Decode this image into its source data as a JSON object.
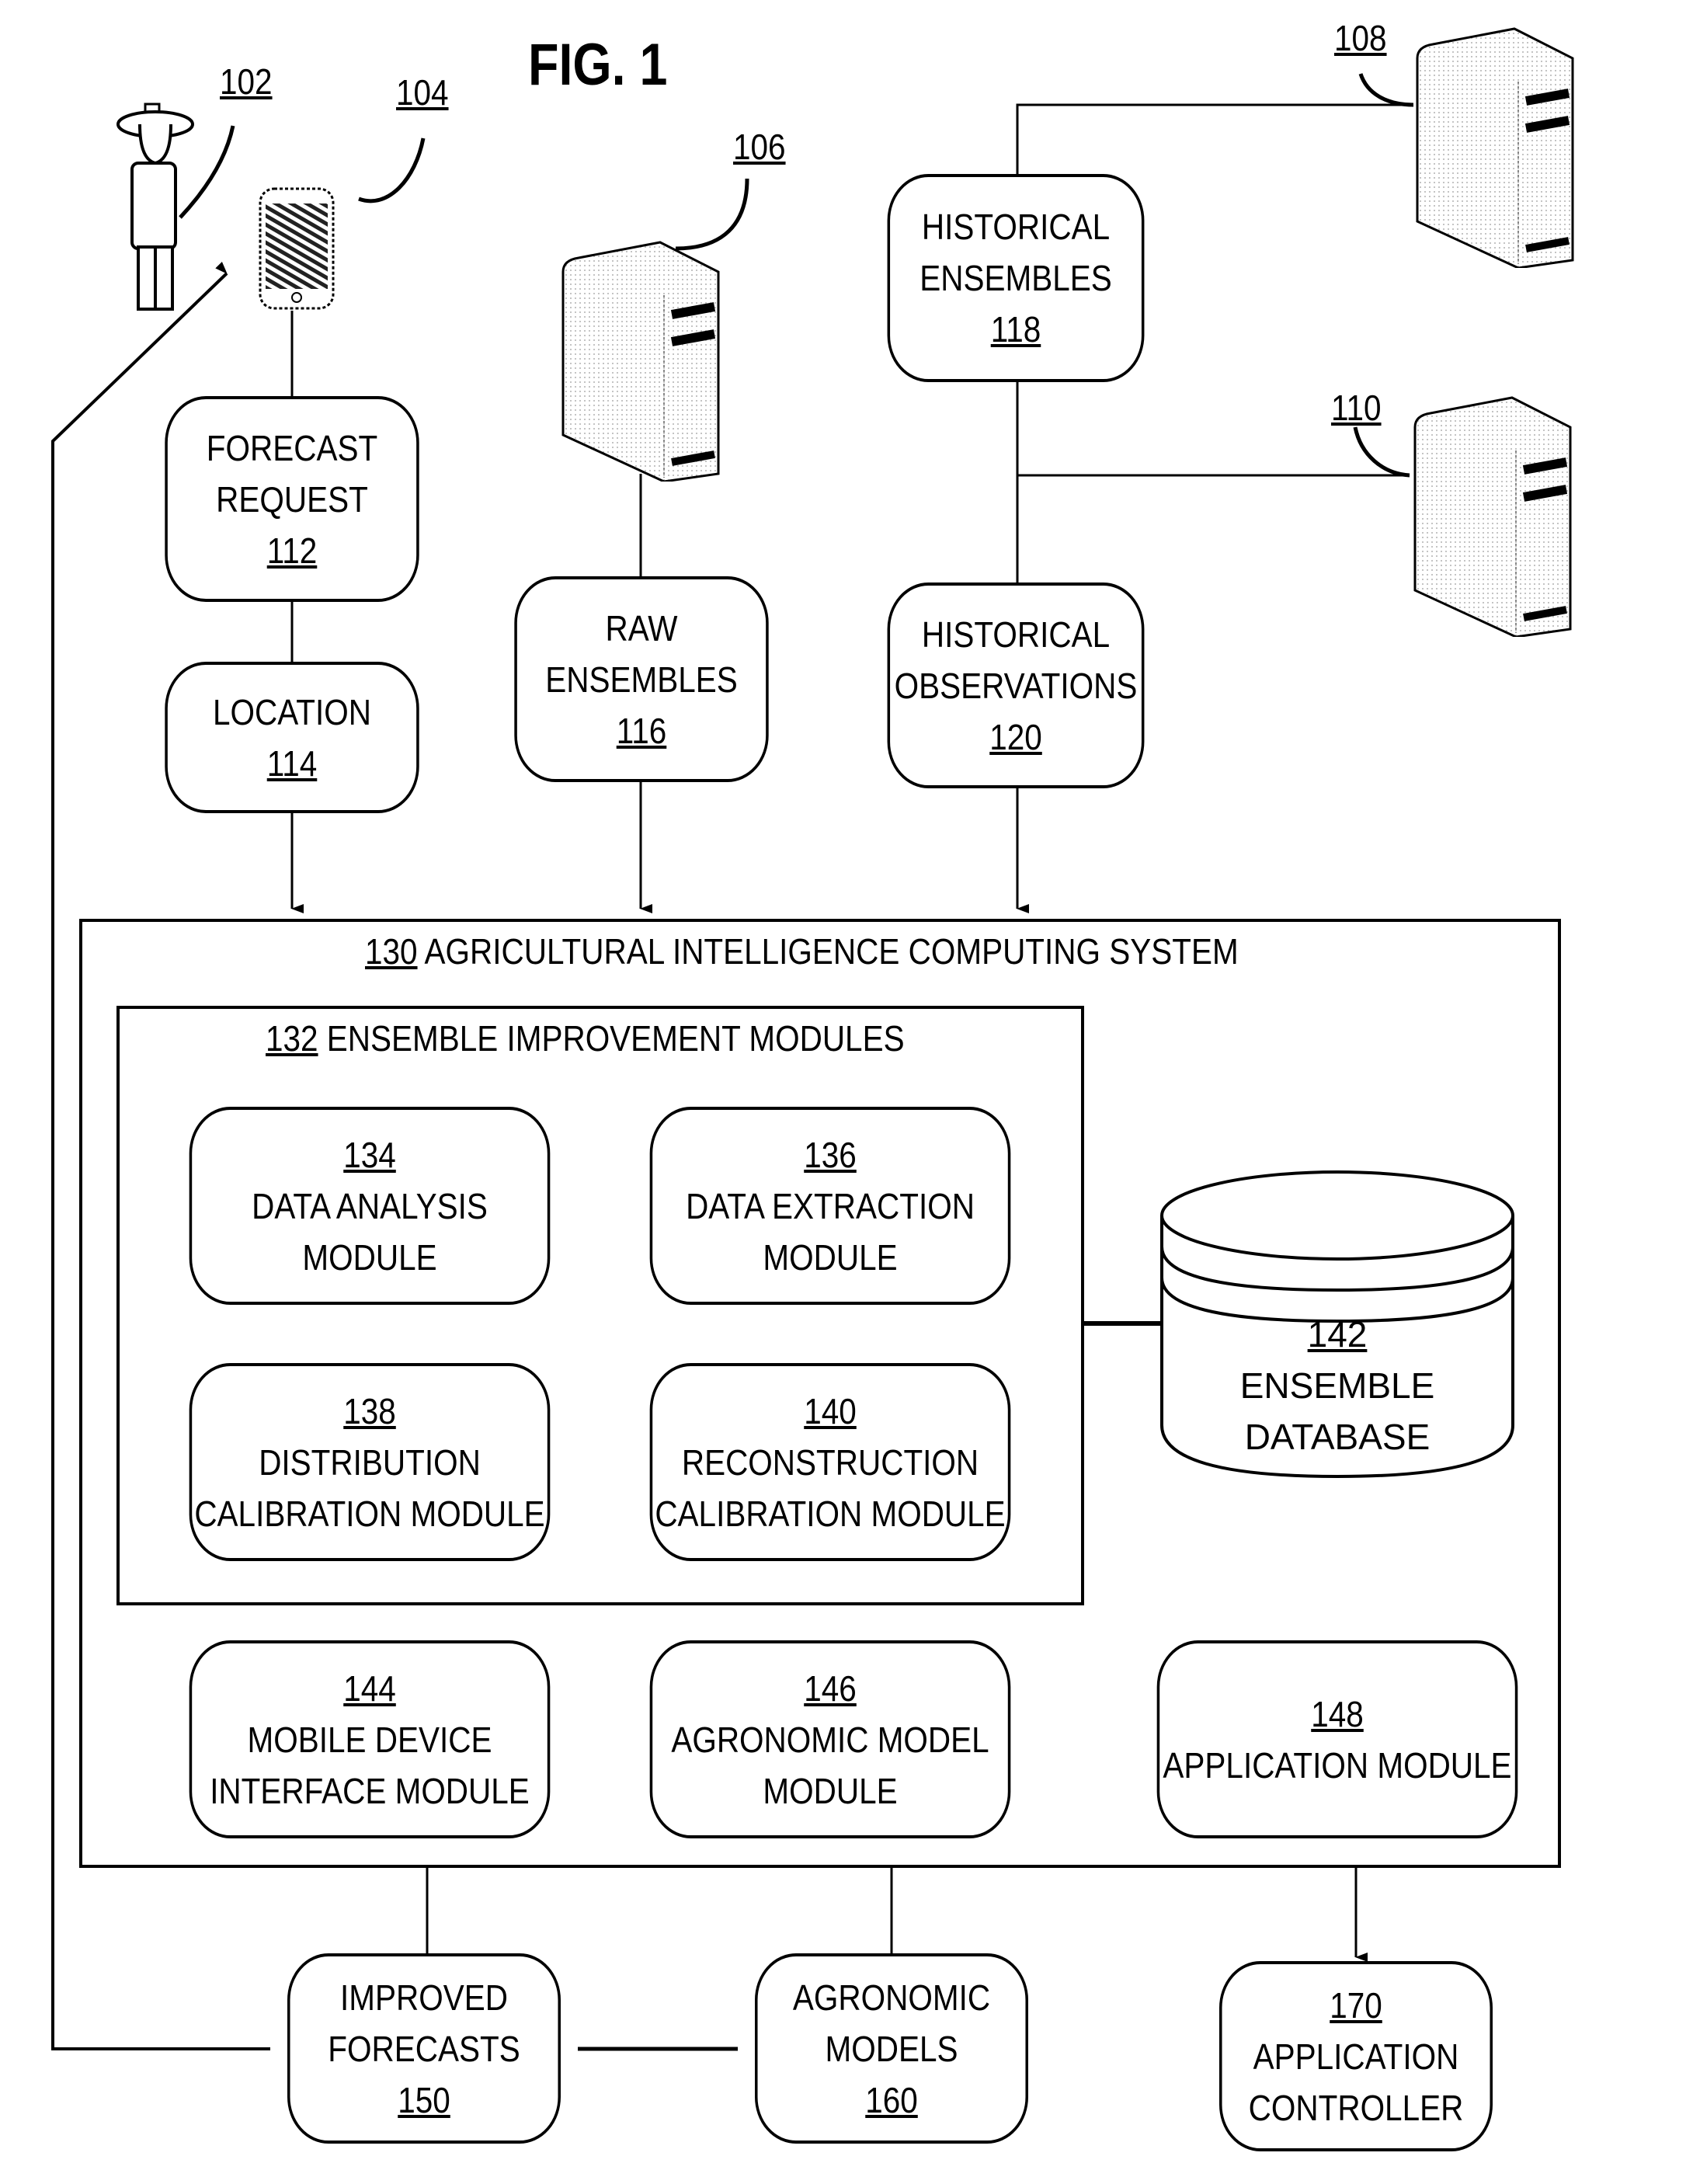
{
  "figure_title": "FIG. 1",
  "refs": {
    "user": "102",
    "mobile_device": "104",
    "server_raw": "106",
    "server_hist_ens": "108",
    "server_hist_obs": "110"
  },
  "nodes": {
    "forecast_request": {
      "lines": [
        "FORECAST",
        "REQUEST"
      ],
      "num": "112"
    },
    "location": {
      "lines": [
        "LOCATION"
      ],
      "num": "114"
    },
    "raw_ensembles": {
      "lines": [
        "RAW",
        "ENSEMBLES"
      ],
      "num": "116"
    },
    "historical_ensembles": {
      "lines": [
        "HISTORICAL",
        "ENSEMBLES"
      ],
      "num": "118"
    },
    "historical_observations": {
      "lines": [
        "HISTORICAL",
        "OBSERVATIONS"
      ],
      "num": "120"
    },
    "improved_forecasts": {
      "lines": [
        "IMPROVED",
        "FORECASTS"
      ],
      "num": "150"
    },
    "agronomic_models": {
      "lines": [
        "AGRONOMIC",
        "MODELS"
      ],
      "num": "160"
    },
    "application_controller": {
      "num": "170",
      "lines": [
        "APPLICATION",
        "CONTROLLER"
      ]
    }
  },
  "system": {
    "num": "130",
    "title": "AGRICULTURAL INTELLIGENCE COMPUTING SYSTEM"
  },
  "ensemble_group": {
    "num": "132",
    "title": "ENSEMBLE IMPROVEMENT MODULES"
  },
  "modules": {
    "data_analysis": {
      "num": "134",
      "lines": [
        "DATA ANALYSIS",
        "MODULE"
      ]
    },
    "data_extraction": {
      "num": "136",
      "lines": [
        "DATA EXTRACTION",
        "MODULE"
      ]
    },
    "distribution_calibration": {
      "num": "138",
      "lines": [
        "DISTRIBUTION",
        "CALIBRATION MODULE"
      ]
    },
    "reconstruction_calibration": {
      "num": "140",
      "lines": [
        "RECONSTRUCTION",
        "CALIBRATION MODULE"
      ]
    },
    "mobile_device_interface": {
      "num": "144",
      "lines": [
        "MOBILE DEVICE",
        "INTERFACE MODULE"
      ]
    },
    "agronomic_model": {
      "num": "146",
      "lines": [
        "AGRONOMIC MODEL",
        "MODULE"
      ]
    },
    "application": {
      "num": "148",
      "lines": [
        "APPLICATION MODULE"
      ]
    }
  },
  "database": {
    "num": "142",
    "lines": [
      "ENSEMBLE",
      "DATABASE"
    ]
  }
}
